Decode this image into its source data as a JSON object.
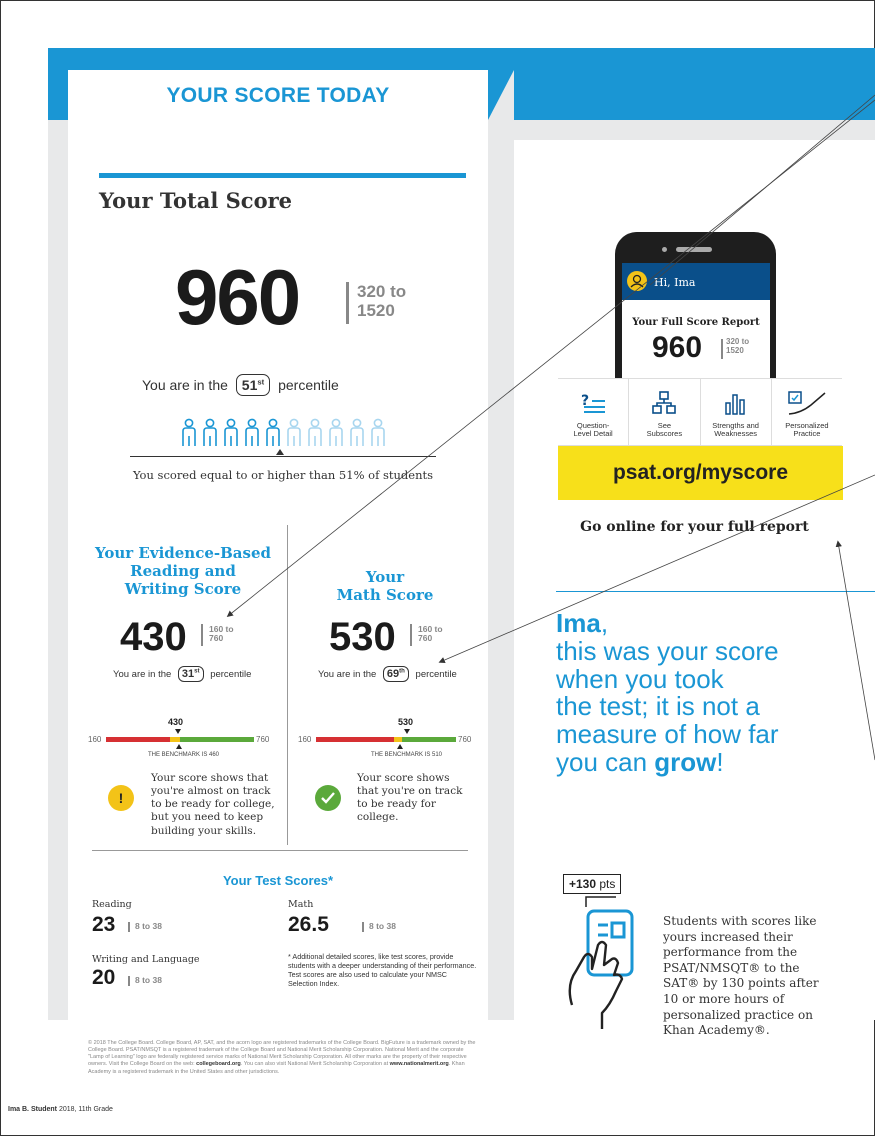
{
  "left_panel": {
    "title": "YOUR SCORE TODAY",
    "total": {
      "heading": "Your Total Score",
      "score": "960",
      "range_low": "320 to",
      "range_high": "1520",
      "pct_prefix": "You are in the",
      "pct_value": "51",
      "pct_suffix_sup": "st",
      "pct_suffix": "percentile",
      "people_total": 10,
      "people_filled": 5,
      "caption": "You scored equal to or higher than 51% of students"
    },
    "ebrw": {
      "title_line1": "Your Evidence-Based",
      "title_line2": "Reading and",
      "title_line3": "Writing Score",
      "score": "430",
      "range_low": "160 to",
      "range_high": "760",
      "pct_prefix": "You are in the",
      "pct_value": "31",
      "pct_sup": "st",
      "pct_suffix": "percentile",
      "bench_min": "160",
      "bench_max": "760",
      "bench_score": "430",
      "benchmark_note": "THE BENCHMARK IS 460",
      "status_text": "Your score shows that you're almost on track to be ready for college, but you need to keep building your skills."
    },
    "math": {
      "title_line1": "Your",
      "title_line2": "Math Score",
      "score": "530",
      "range_low": "160 to",
      "range_high": "760",
      "pct_prefix": "You are in the",
      "pct_value": "69",
      "pct_sup": "th",
      "pct_suffix": "percentile",
      "bench_min": "160",
      "bench_max": "760",
      "bench_score": "530",
      "benchmark_note": "THE BENCHMARK IS 510",
      "status_text": "Your score shows that you're on track to be ready for college."
    },
    "tests": {
      "title": "Your Test Scores*",
      "reading_label": "Reading",
      "reading_value": "23",
      "reading_range": "8 to 38",
      "writing_label": "Writing and Language",
      "writing_value": "20",
      "writing_range": "8 to 38",
      "math_label": "Math",
      "math_value": "26.5",
      "math_range": "8 to 38",
      "footnote": "* Additional detailed scores, like test scores, provide students with a deeper understanding of their performance. Test scores are also used to calculate your NMSC Selection Index."
    },
    "legal": {
      "text1": "© 2018 The College Board. College Board, AP, SAT, and the acorn logo are registered trademarks of the College Board. BigFuture is a trademark owned by the College Board. PSAT/NMSQT is a registered trademark of the College Board and National Merit Scholarship Corporation. National Merit and the corporate \"Lamp of Learning\" logo are federally registered service marks of National Merit Scholarship Corporation. All other marks are the property of their respective owners. Visit the College Board on the web:",
      "link1": "collegeboard.org",
      "text2": ". You can also visit National Merit Scholarship Corporation at",
      "link2": "www.nationalmerit.org",
      "text3": ". Khan Academy is a registered trademark in the United States and other jurisdictions."
    }
  },
  "right_panel": {
    "phone": {
      "greeting": "Hi, Ima",
      "report_title": "Your Full Score Report",
      "score": "960",
      "range_low": "320 to",
      "range_high": "1520"
    },
    "features": [
      {
        "label_line1": "Question-",
        "label_line2": "Level Detail",
        "icon": "question-list-icon"
      },
      {
        "label_line1": "See",
        "label_line2": "Subscores",
        "icon": "hierarchy-icon"
      },
      {
        "label_line1": "Strengths and",
        "label_line2": "Weaknesses",
        "icon": "bar-chart-icon"
      },
      {
        "label_line1": "Personalized",
        "label_line2": "Practice",
        "icon": "trend-icon"
      }
    ],
    "url": "psat.org/myscore",
    "go_online": "Go online for your full report",
    "message": {
      "name": "Ima",
      "comma": ",",
      "line1": "this was your score",
      "line2": "when you took",
      "line3": "the test; it is not a",
      "line4": "measure of how far",
      "line5_pre": "you can ",
      "line5_bold": "grow",
      "line5_post": "!"
    },
    "khan": {
      "badge_value": "+130",
      "badge_unit": " pts",
      "text": "Students with scores like yours increased their performance from the PSAT/NMSQT® to the SAT® by 130 points after 10 or more hours of personalized practice on Khan Academy®."
    }
  },
  "footer": {
    "name": "Ima B. Student",
    "detail": "2018, 11th Grade"
  },
  "colors": {
    "brand_blue": "#1a96d4",
    "dark_blue": "#0a4f8a",
    "yellow": "#f7e01a",
    "red": "#d63033",
    "green": "#5ba93b"
  }
}
